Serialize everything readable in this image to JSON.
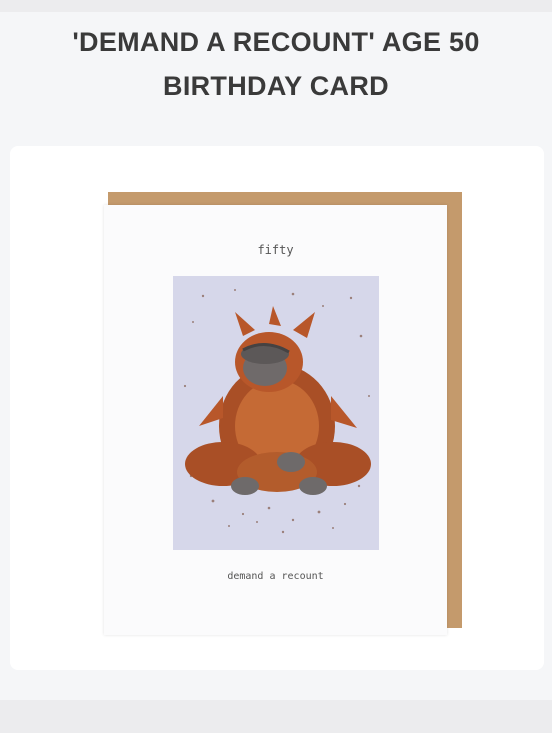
{
  "page": {
    "title_line1": "'DEMAND A RECOUNT' AGE 50",
    "title_line2": "BIRTHDAY CARD"
  },
  "card": {
    "top_text": "fifty",
    "bottom_text": "demand a recount",
    "illustration": "orangutan-covering-face"
  },
  "colors": {
    "background": "#f5f6f8",
    "envelope": "#c49a6c",
    "art_background": "#d6d7ea",
    "fur": "#b8572a"
  }
}
